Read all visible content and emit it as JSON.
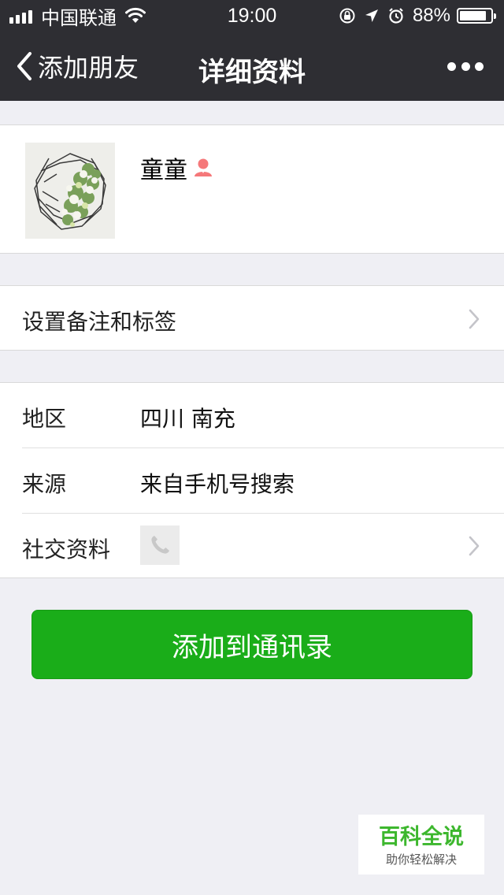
{
  "status_bar": {
    "carrier": "中国联通",
    "time": "19:00",
    "battery": "88%",
    "battery_level": 0.88
  },
  "nav": {
    "back_label": "添加朋友",
    "title": "详细资料",
    "more_icon": "ellipsis-icon"
  },
  "profile": {
    "nickname": "童童",
    "gender_icon": "female-icon",
    "gender_color": "#f5787a"
  },
  "remark": {
    "label": "设置备注和标签"
  },
  "info": {
    "region_label": "地区",
    "region_value": "四川 南充",
    "source_label": "来源",
    "source_value": "来自手机号搜索",
    "social_label": "社交资料",
    "social_icon": "phone-icon"
  },
  "actions": {
    "add_label": "添加到通讯录",
    "add_color": "#1aad19"
  },
  "watermark": {
    "title": "百科全说",
    "subtitle": "助你轻松解决"
  }
}
